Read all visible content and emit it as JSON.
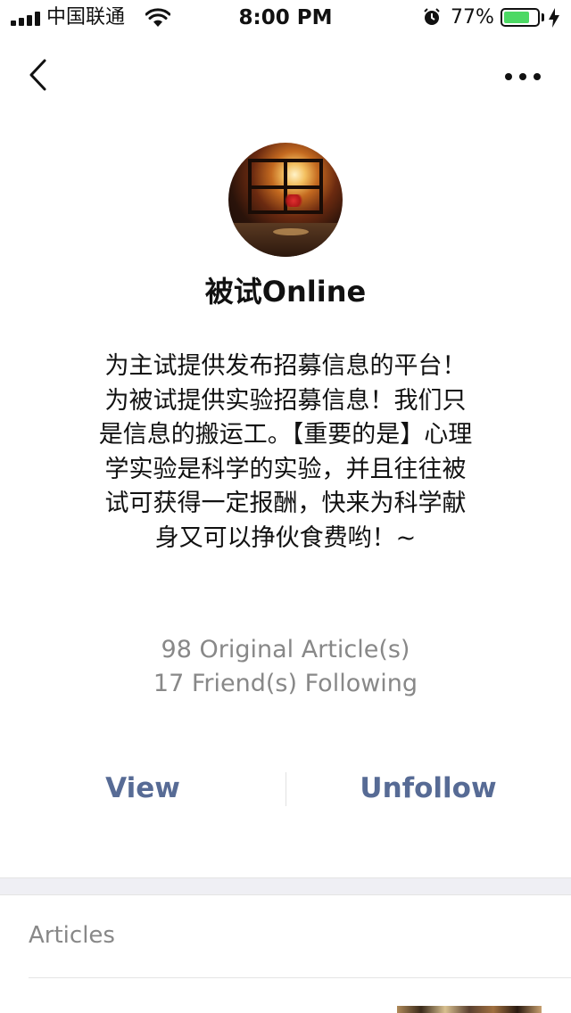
{
  "status_bar": {
    "carrier": "中国联通",
    "time": "8:00 PM",
    "battery_percent": "77%",
    "battery_level": 0.77
  },
  "nav": {
    "back_icon": "chevron-left-icon",
    "more_icon": "more-dots-icon"
  },
  "profile": {
    "name": "被试Online",
    "description": "为主试提供发布招募信息的平台！为被试提供实验招募信息！我们只是信息的搬运工。【重要的是】心理学实验是科学的实验，并且往往被试可获得一定报酬，快来为科学献身又可以挣伙食费哟！~",
    "original_articles": "98 Original Article(s)",
    "friends_following": "17 Friend(s) Following"
  },
  "actions": {
    "view_label": "View",
    "unfollow_label": "Unfollow"
  },
  "articles": {
    "section_label": "Articles"
  },
  "colors": {
    "link": "#576b95",
    "secondary_text": "#888888",
    "battery_green": "#4cd964"
  }
}
